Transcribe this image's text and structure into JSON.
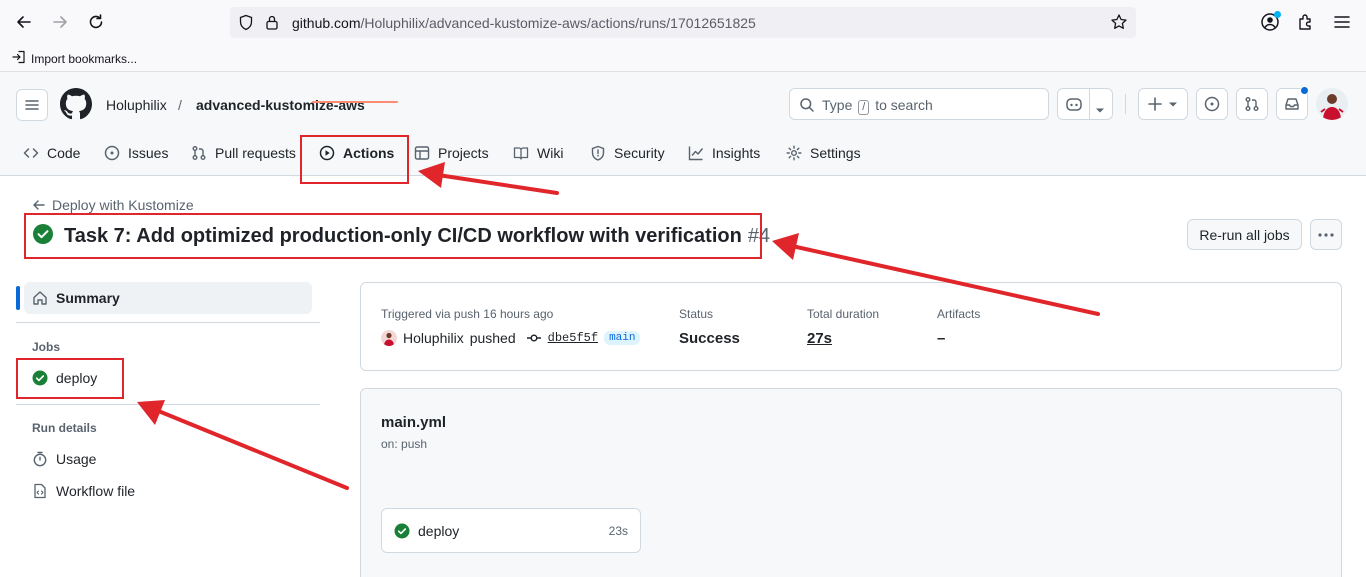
{
  "browser": {
    "url_host": "github.com",
    "url_path": "/Holuphilix/advanced-kustomize-aws/actions/runs/17012651825",
    "bookmarks": [
      "Import bookmarks..."
    ]
  },
  "header": {
    "owner": "Holuphilix",
    "separator": "/",
    "repo": "advanced-kustomize-aws",
    "search_placeholder_pre": "Type",
    "search_key": "/",
    "search_placeholder_post": "to search"
  },
  "tabs": [
    {
      "label": "Code",
      "icon": "code-icon"
    },
    {
      "label": "Issues",
      "icon": "issue-icon"
    },
    {
      "label": "Pull requests",
      "icon": "pull-request-icon"
    },
    {
      "label": "Actions",
      "icon": "play-icon",
      "selected": true
    },
    {
      "label": "Projects",
      "icon": "table-icon"
    },
    {
      "label": "Wiki",
      "icon": "book-icon"
    },
    {
      "label": "Security",
      "icon": "shield-icon"
    },
    {
      "label": "Insights",
      "icon": "graph-icon"
    },
    {
      "label": "Settings",
      "icon": "gear-icon"
    }
  ],
  "run": {
    "back_label": "Deploy with Kustomize",
    "title": "Task 7: Add optimized production-only CI/CD workflow with verification",
    "number": "#4",
    "rerun_label": "Re-run all jobs"
  },
  "sidebar": {
    "summary_label": "Summary",
    "jobs_heading": "Jobs",
    "jobs": [
      {
        "label": "deploy",
        "status": "success"
      }
    ],
    "run_details_heading": "Run details",
    "details": [
      {
        "label": "Usage",
        "icon": "stopwatch-icon"
      },
      {
        "label": "Workflow file",
        "icon": "file-code-icon"
      }
    ]
  },
  "summary": {
    "triggered_label": "Triggered via push 16 hours ago",
    "actor": "Holuphilix",
    "action": "pushed",
    "commit_sha": "dbe5f5f",
    "branch": "main",
    "status_label": "Status",
    "status_value": "Success",
    "duration_label": "Total duration",
    "duration_value": "27s",
    "artifacts_label": "Artifacts",
    "artifacts_value": "–"
  },
  "workflow": {
    "file": "main.yml",
    "trigger": "on: push",
    "jobs": [
      {
        "name": "deploy",
        "duration": "23s",
        "status": "success"
      }
    ]
  },
  "colors": {
    "success": "#1a7f37",
    "accent": "#0969da",
    "annotation": "#e0262b",
    "tab_underline": "#fd8c73"
  }
}
